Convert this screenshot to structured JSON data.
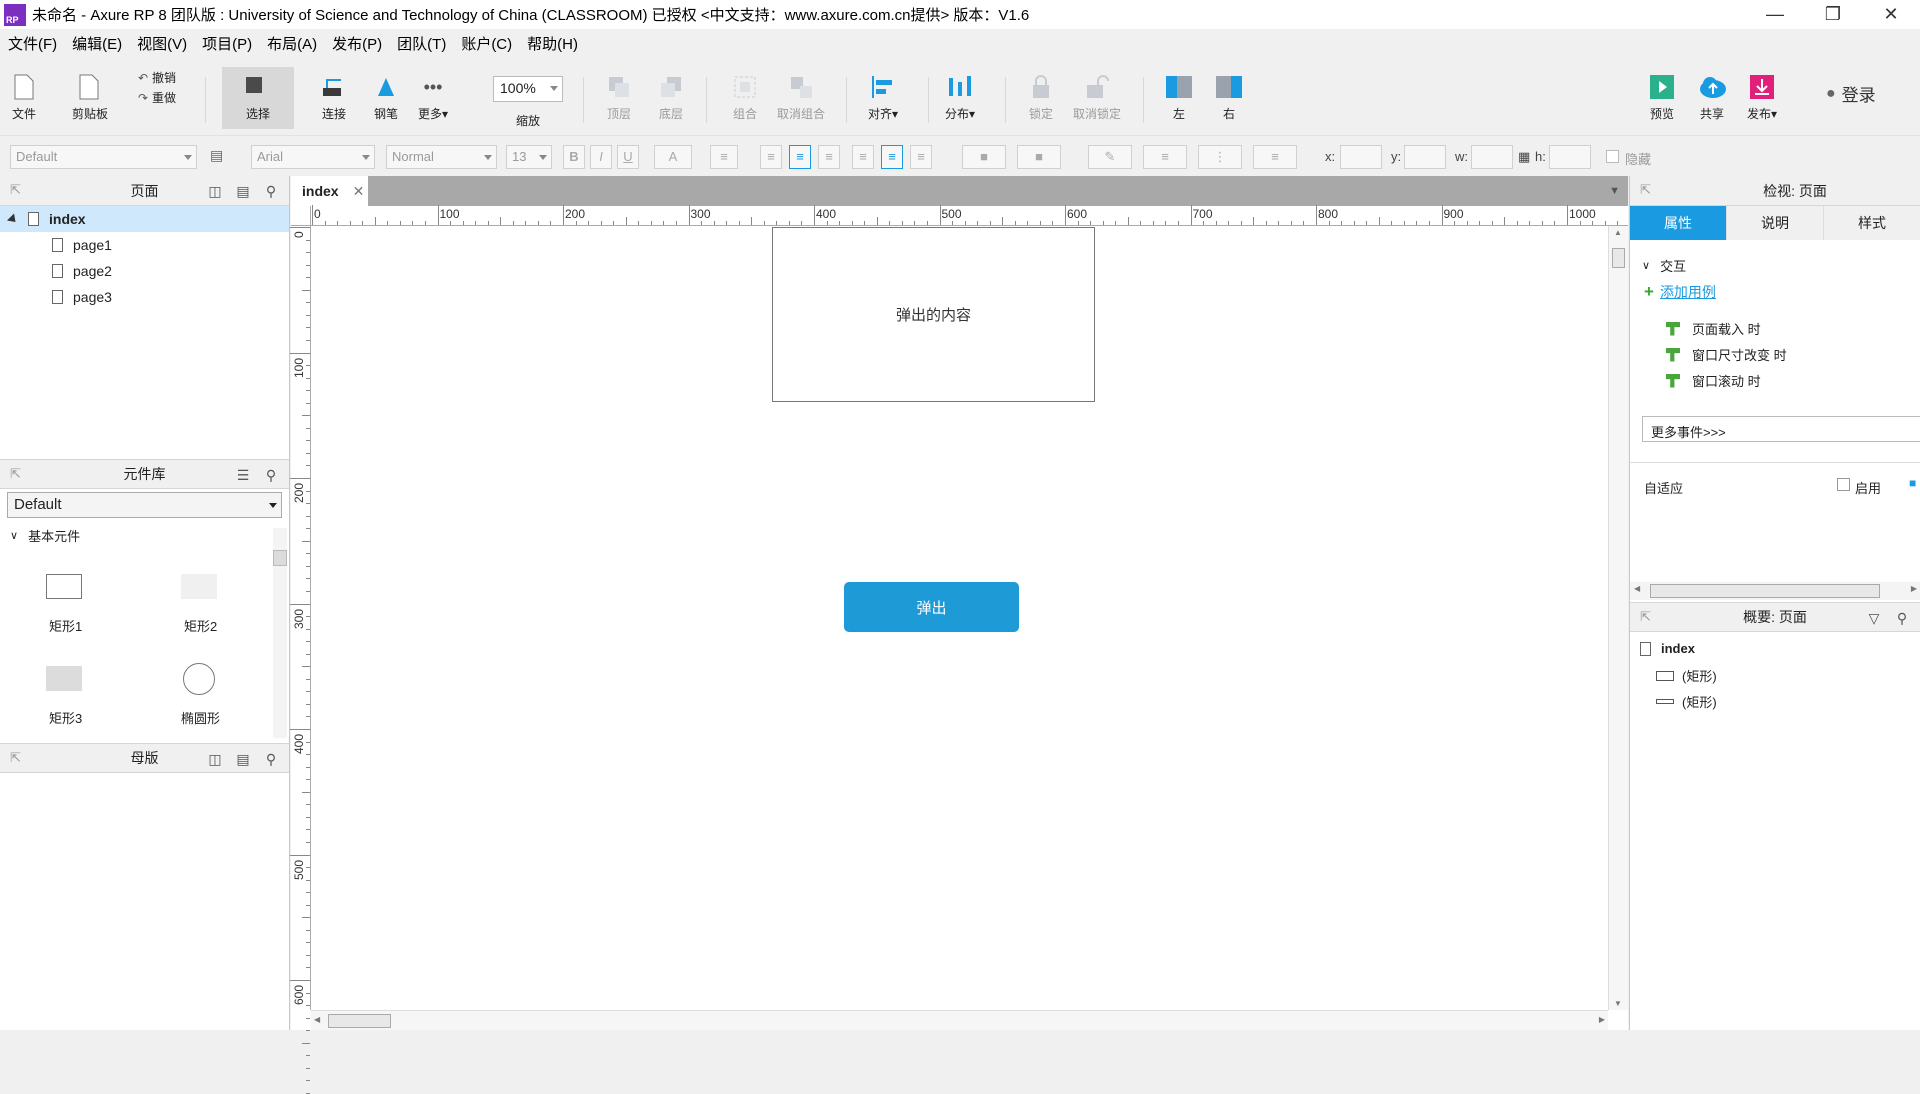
{
  "window": {
    "logo": "RP",
    "title": "未命名 - Axure RP 8 团队版 : University of Science and Technology of China (CLASSROOM) 已授权      <中文支持：www.axure.com.cn提供> 版本：V1.6"
  },
  "menu": [
    "文件(F)",
    "编辑(E)",
    "视图(V)",
    "项目(P)",
    "布局(A)",
    "发布(P)",
    "团队(T)",
    "账户(C)",
    "帮助(H)"
  ],
  "toolbar": {
    "file": "文件",
    "clipboard": "剪贴板",
    "undo": "撤销",
    "redo": "重做",
    "select": "选择",
    "connect": "连接",
    "pen": "钢笔",
    "more": "更多▾",
    "zoom_value": "100%",
    "zoom_label": "缩放",
    "top_layer": "顶层",
    "bottom_layer": "底层",
    "group": "组合",
    "ungroup": "取消组合",
    "align": "对齐▾",
    "distribute": "分布▾",
    "lock": "锁定",
    "unlock": "取消锁定",
    "left": "左",
    "right": "右",
    "preview": "预览",
    "share": "共享",
    "publish": "发布▾",
    "login": "登录"
  },
  "formatbar": {
    "style": "Default",
    "font": "Arial",
    "weight": "Normal",
    "size": "13",
    "bold": "B",
    "italic": "I",
    "underline": "U",
    "font_color": "A",
    "x_label": "x:",
    "y_label": "y:",
    "w_label": "w:",
    "h_label": "h:",
    "hide_label": "隐藏"
  },
  "pages_panel": {
    "title": "页面",
    "pages": [
      {
        "name": "index",
        "selected": true
      },
      {
        "name": "page1",
        "selected": false
      },
      {
        "name": "page2",
        "selected": false
      },
      {
        "name": "page3",
        "selected": false
      }
    ]
  },
  "library_panel": {
    "title": "元件库",
    "library": "Default",
    "section": "基本元件",
    "widgets": [
      "矩形1",
      "矩形2",
      "矩形3",
      "椭圆形"
    ]
  },
  "masters_panel": {
    "title": "母版"
  },
  "canvas": {
    "tab": "index",
    "ruler_h": [
      "0",
      "100",
      "200",
      "300",
      "400",
      "500",
      "600",
      "700",
      "800",
      "900",
      "1000"
    ],
    "ruler_v": [
      "0",
      "100",
      "200",
      "300",
      "400",
      "500",
      "600"
    ],
    "popup_text": "弹出的内容",
    "button_text": "弹出"
  },
  "inspector": {
    "title": "检视: 页面",
    "tabs": [
      "属性",
      "说明",
      "样式"
    ],
    "section": "交互",
    "add_case": "添加用例",
    "events": [
      "页面载入 时",
      "窗口尺寸改变 时",
      "窗口滚动 时"
    ],
    "more_events": "更多事件>>>",
    "adaptive": "自适应",
    "enable": "启用"
  },
  "outline": {
    "title": "概要: 页面",
    "root": "index",
    "items": [
      "(矩形)",
      "(矩形)"
    ]
  },
  "colors": {
    "accent": "#1a9ae0",
    "button": "#1e9ad6",
    "logo": "#7b2fbf"
  }
}
